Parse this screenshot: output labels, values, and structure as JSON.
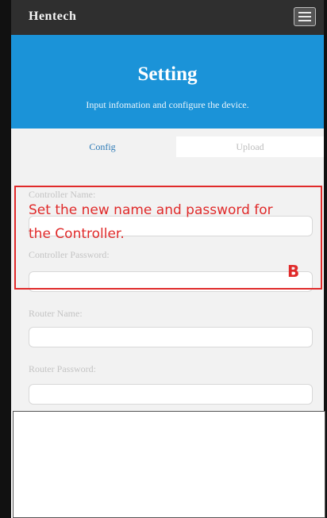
{
  "app": {
    "brand": "Hentech"
  },
  "header": {
    "title": "Setting",
    "subtitle": "Input infomation and configure the device."
  },
  "tabs": [
    {
      "label": "Config",
      "active": true
    },
    {
      "label": "Upload",
      "active": false
    }
  ],
  "form": {
    "controller_name_label": "Controller Name:",
    "controller_password_label": "Controller Password:",
    "router_name_label": "Router Name:",
    "router_password_label": "Router Password:"
  },
  "annotation": {
    "text": "Set the new name and password for the Controller.",
    "letter": "B",
    "color": "#e02a2a"
  },
  "colors": {
    "header_bg": "#1b93d8",
    "topbar_bg": "#2f2f2f",
    "content_bg": "#f2f2f2"
  },
  "icons": {
    "menu": "hamburger-menu-icon"
  }
}
